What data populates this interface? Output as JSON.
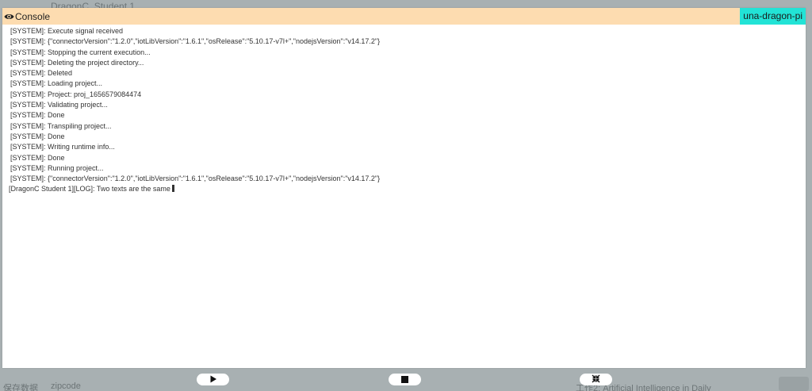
{
  "background": {
    "header_text": "DragonC_Student 1",
    "footer_left": "保存数据",
    "footer_mid": "zipcode",
    "footer_right": "工作2: Artificial Intelligence in Daily"
  },
  "console": {
    "title": "Console",
    "device": "una-dragon-pi",
    "lines": [
      "[SYSTEM]: Execute signal received",
      "[SYSTEM]: {\"connectorVersion\":\"1.2.0\",\"iotLibVersion\":\"1.6.1\",\"osRelease\":\"5.10.17-v7l+\",\"nodejsVersion\":\"v14.17.2\"}",
      "[SYSTEM]: Stopping the current execution...",
      "[SYSTEM]: Deleting the project directory...",
      "[SYSTEM]: Deleted",
      "[SYSTEM]: Loading project...",
      "[SYSTEM]: Project: proj_1656579084474",
      "[SYSTEM]: Validating project...",
      "[SYSTEM]: Done",
      "[SYSTEM]: Transpiling project...",
      "[SYSTEM]: Done",
      "[SYSTEM]: Writing runtime info...",
      "[SYSTEM]: Done",
      "[SYSTEM]: Running project...",
      "[SYSTEM]: {\"connectorVersion\":\"1.2.0\",\"iotLibVersion\":\"1.6.1\",\"osRelease\":\"5.10.17-v7l+\",\"nodejsVersion\":\"v14.17.2\"}",
      "[DragonC Student 1][LOG]: Two texts are the same"
    ]
  },
  "controls": {
    "play_icon": "play-icon",
    "stop_icon": "stop-icon",
    "collapse_icon": "collapse-icon"
  },
  "colors": {
    "header": "#fddcb0",
    "badge": "#22e3d6",
    "overlay": "#9ea6a8"
  }
}
